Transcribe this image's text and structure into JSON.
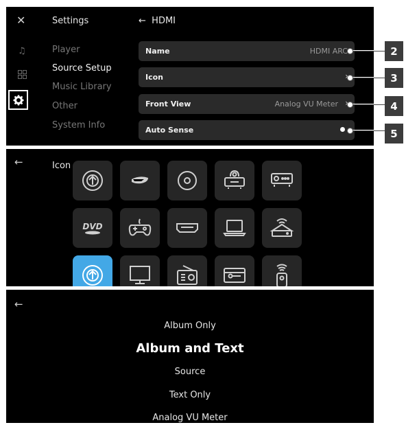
{
  "settings": {
    "title": "Settings",
    "nav": [
      "Player",
      "Source Setup",
      "Music Library",
      "Other",
      "System Info"
    ],
    "active_index": 1
  },
  "hdmi": {
    "title": "HDMI",
    "rows": [
      {
        "label": "Name",
        "value": "HDMI ARC",
        "chevron": false
      },
      {
        "label": "Icon",
        "value": "",
        "chevron": true
      },
      {
        "label": "Front View",
        "value": "Analog VU Meter",
        "chevron": true
      },
      {
        "label": "Auto Sense",
        "value": "",
        "toggle": true
      }
    ]
  },
  "callouts": [
    "2",
    "3",
    "4",
    "5"
  ],
  "icon_picker": {
    "title": "Icon",
    "icons": [
      "antenna-icon",
      "bluray-icon",
      "disc-icon",
      "projector-icon",
      "receiver-icon",
      "dvd-icon",
      "gamepad-icon",
      "hdmi-port-icon",
      "laptop-icon",
      "router-icon",
      "airplay-icon",
      "monitor-icon",
      "radio-icon",
      "card-reader-icon",
      "remote-icon"
    ],
    "dvd_text": "DVD",
    "selected": "airplay-icon"
  },
  "front_view_options": {
    "items": [
      "Album Only",
      "Album and Text",
      "Source",
      "Text Only",
      "Analog VU Meter"
    ],
    "selected": "Album and Text"
  },
  "colors": {
    "accent": "#43a8e6",
    "panel_bg": "#000000",
    "row_bg": "#2a2a2a",
    "callout_bg": "#3c3c3c"
  }
}
